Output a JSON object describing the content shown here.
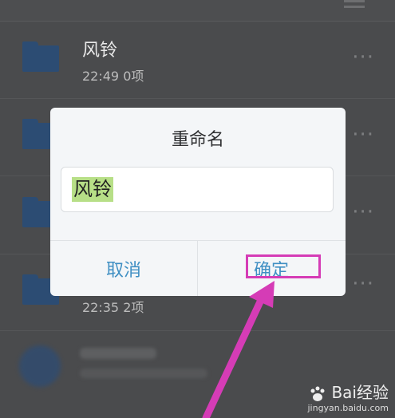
{
  "folders": [
    {
      "title": "风铃",
      "meta": "22:49  0项"
    },
    {
      "title": "",
      "meta": ""
    },
    {
      "title": "",
      "meta": ""
    },
    {
      "title": "",
      "meta": "22:35  2项"
    }
  ],
  "more_label": "···",
  "dialog": {
    "title": "重命名",
    "input_value": "风铃",
    "cancel_label": "取消",
    "confirm_label": "确定"
  },
  "annotation": {
    "color": "#d53cb6"
  },
  "watermark": {
    "brand": "Bai经验",
    "url": "jingyan.baidu.com"
  }
}
